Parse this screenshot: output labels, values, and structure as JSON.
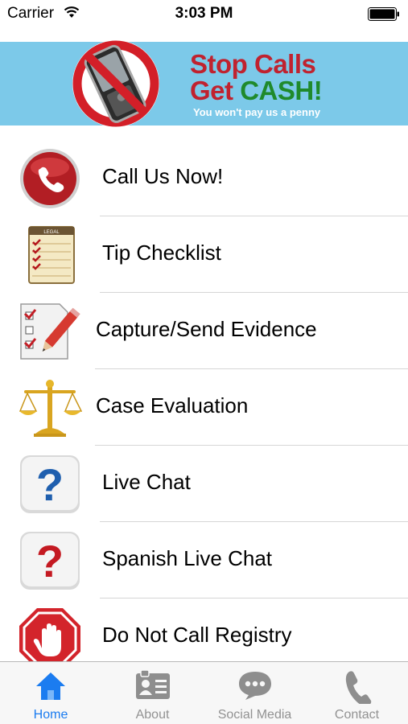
{
  "status_bar": {
    "carrier": "Carrier",
    "time": "3:03 PM"
  },
  "banner": {
    "line1": "Stop Calls",
    "line2_prefix": "Get ",
    "line2_highlight": "CASH!",
    "tagline": "You won't pay us a penny",
    "colors": {
      "background": "#7cc9e9",
      "red": "#c0222f",
      "green": "#1f8a2b"
    }
  },
  "menu": {
    "items": [
      {
        "label": "Call Us Now!",
        "icon": "phone-red-icon"
      },
      {
        "label": "Tip Checklist",
        "icon": "legal-pad-checklist-icon"
      },
      {
        "label": "Capture/Send Evidence",
        "icon": "checklist-pencil-icon"
      },
      {
        "label": "Case Evaluation",
        "icon": "scales-of-justice-icon"
      },
      {
        "label": "Live Chat",
        "icon": "blue-question-icon"
      },
      {
        "label": "Spanish Live Chat",
        "icon": "red-question-icon"
      },
      {
        "label": "Do Not Call Registry",
        "icon": "stop-hand-icon"
      }
    ]
  },
  "tab_bar": {
    "active_color": "#1b7cf0",
    "inactive_color": "#929292",
    "tabs": [
      {
        "label": "Home",
        "icon": "home-icon",
        "active": true
      },
      {
        "label": "About",
        "icon": "contact-card-icon",
        "active": false
      },
      {
        "label": "Social Media",
        "icon": "speech-bubble-icon",
        "active": false
      },
      {
        "label": "Contact",
        "icon": "phone-handset-icon",
        "active": false
      }
    ]
  }
}
